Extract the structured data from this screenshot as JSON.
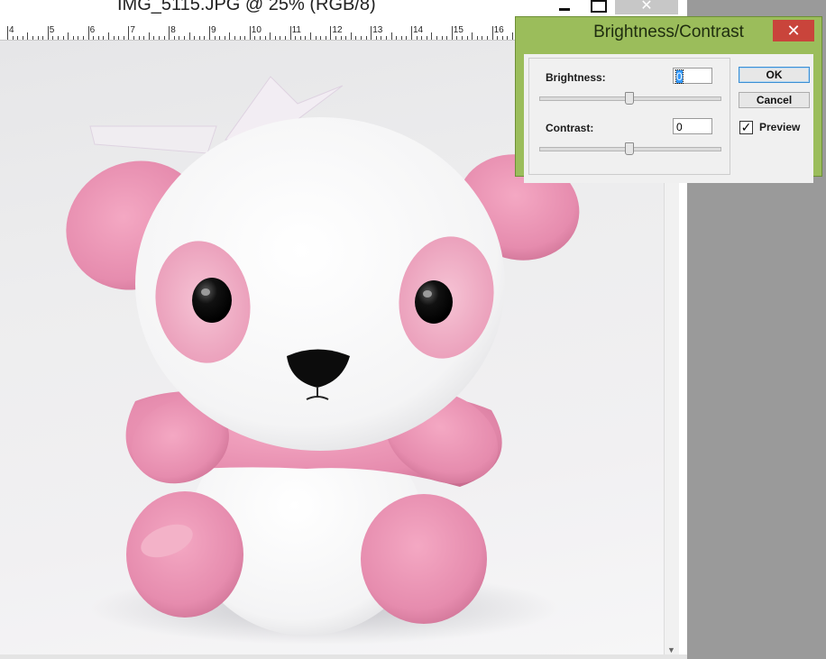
{
  "document": {
    "title": "IMG_5115.JPG @ 25% (RGB/8)",
    "zoom": "25%",
    "ruler_labels": [
      "4",
      "5",
      "6",
      "7",
      "8",
      "9",
      "10",
      "11",
      "12",
      "13",
      "14",
      "15",
      "16"
    ]
  },
  "window_controls": {
    "minimize_icon": "minimize-icon",
    "maximize_icon": "maximize-icon",
    "close_glyph": "✕"
  },
  "dialog": {
    "title": "Brightness/Contrast",
    "close_glyph": "✕",
    "brightness": {
      "label": "Brightness:",
      "value": "0",
      "slider_level": 0.5
    },
    "contrast": {
      "label": "Contrast:",
      "value": "0",
      "slider_level": 0.5
    },
    "ok_label": "OK",
    "cancel_label": "Cancel",
    "preview": {
      "label": "Preview",
      "checked": true,
      "check_glyph": "✓"
    }
  },
  "colors": {
    "dialog_frame": "#9bbd5b",
    "close_button": "#c9443b",
    "canvas_bg": "#ececee",
    "panda_pink": "#e892b2",
    "panda_white": "#fbfbfb"
  }
}
